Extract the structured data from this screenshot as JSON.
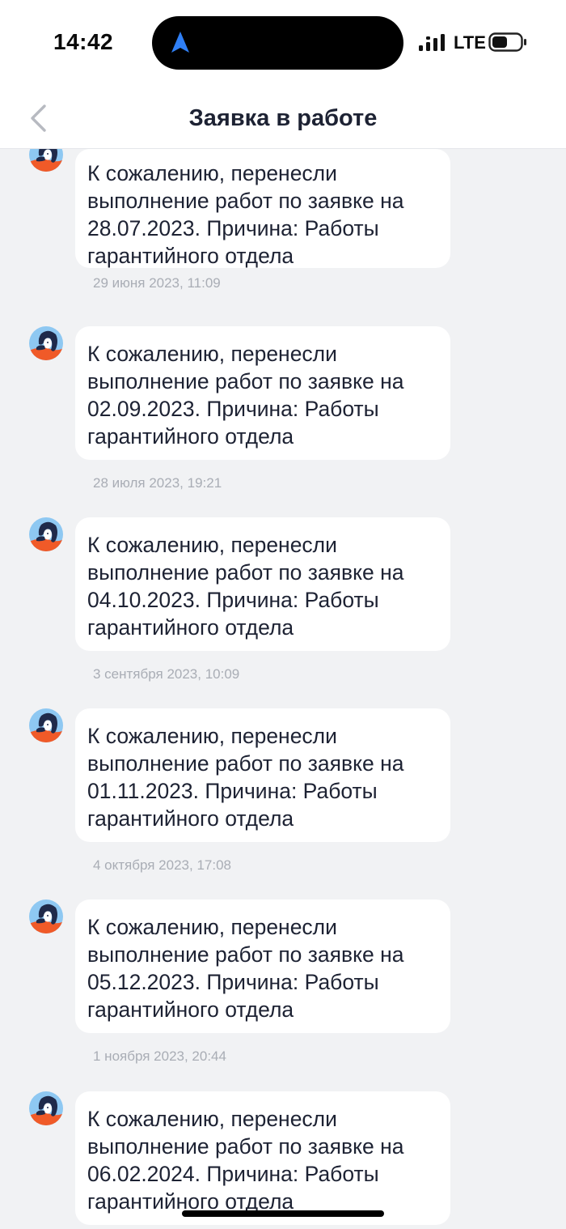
{
  "status_bar": {
    "time": "14:42",
    "network": "LTE"
  },
  "header": {
    "title": "Заявка в работе",
    "back_icon": "chevron-left-icon"
  },
  "messages": [
    {
      "text": "К сожалению, перенесли выполнение работ по заявке на 28.07.2023. Причина: Работы гарантийного отдела",
      "time": "29 июня 2023, 11:09"
    },
    {
      "text": "К сожалению, перенесли выполнение работ по заявке на 02.09.2023. Причина: Работы гарантийного отдела",
      "time": "28 июля 2023, 19:21"
    },
    {
      "text": "К сожалению, перенесли выполнение работ по заявке на 04.10.2023. Причина: Работы гарантийного отдела",
      "time": "3 сентября 2023, 10:09"
    },
    {
      "text": "К сожалению, перенесли выполнение работ по заявке на 01.11.2023. Причина: Работы гарантийного отдела",
      "time": "4 октября 2023, 17:08"
    },
    {
      "text": "К сожалению, перенесли выполнение работ по заявке на 05.12.2023. Причина: Работы гарантийного отдела",
      "time": "1 ноября 2023, 20:44"
    },
    {
      "text": "К сожалению, перенесли выполнение работ по заявке на 06.02.2024. Причина: Работы гарантийного отдела",
      "time": ""
    }
  ],
  "colors": {
    "background": "#f1f2f4",
    "bubble": "#ffffff",
    "text": "#1d2233",
    "timestamp": "#a9adb5",
    "accent_blue": "#2f7ff5",
    "avatar_sky": "#8ec8f2",
    "avatar_orange": "#f05a28"
  }
}
